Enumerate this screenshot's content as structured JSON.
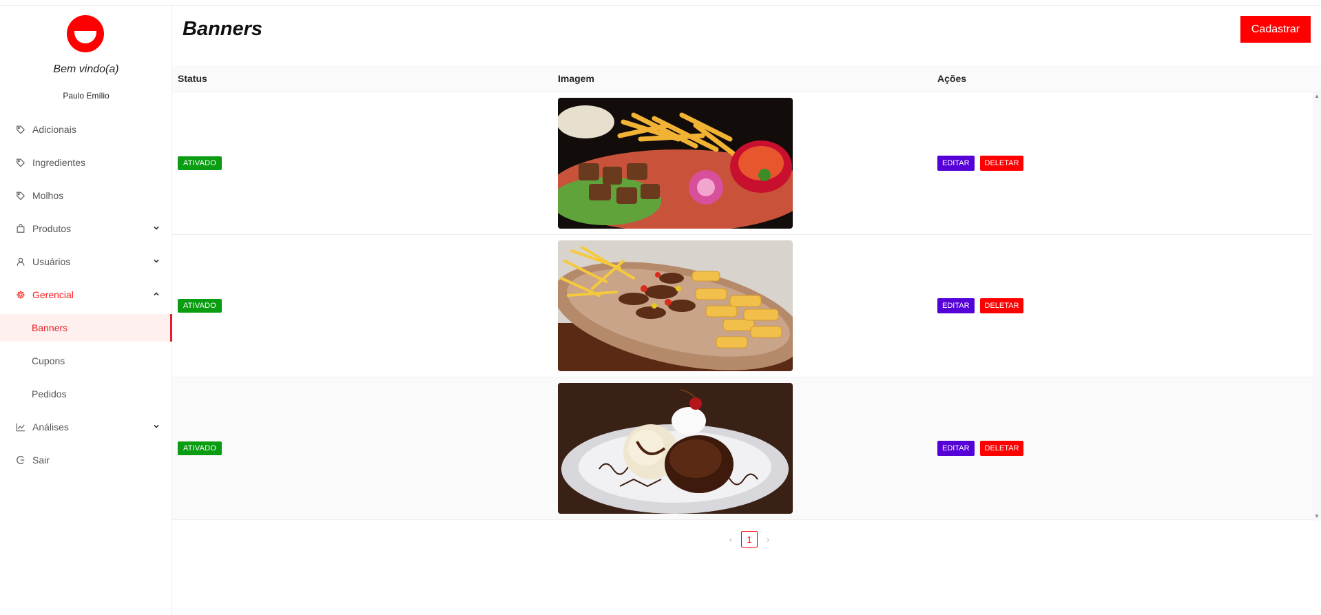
{
  "sidebar": {
    "welcome": "Bem vindo(a)",
    "username": "Paulo Emílio",
    "items": [
      {
        "label": "Adicionais",
        "icon": "tag-icon"
      },
      {
        "label": "Ingredientes",
        "icon": "tag-icon"
      },
      {
        "label": "Molhos",
        "icon": "tag-icon"
      },
      {
        "label": "Produtos",
        "icon": "shopping-bag-icon",
        "expandable": true
      },
      {
        "label": "Usuários",
        "icon": "user-icon",
        "expandable": true
      },
      {
        "label": "Gerencial",
        "icon": "gear-icon",
        "expanded": true,
        "active": true
      },
      {
        "label": "Análises",
        "icon": "line-chart-icon",
        "expandable": true
      },
      {
        "label": "Sair",
        "icon": "logout-icon"
      }
    ],
    "gerencial_sub": [
      {
        "label": "Banners",
        "selected": true
      },
      {
        "label": "Cupons"
      },
      {
        "label": "Pedidos"
      }
    ]
  },
  "header": {
    "title": "Banners",
    "create_label": "Cadastrar"
  },
  "table": {
    "columns": [
      "Status",
      "Imagem",
      "Ações"
    ],
    "rows": [
      {
        "status": "ATIVADO",
        "image": "food-platter-image",
        "edit": "EDITAR",
        "delete": "DELETAR"
      },
      {
        "status": "ATIVADO",
        "image": "beef-fries-image",
        "edit": "EDITAR",
        "delete": "DELETAR"
      },
      {
        "status": "ATIVADO",
        "image": "brownie-dessert-image",
        "edit": "EDITAR",
        "delete": "DELETAR"
      }
    ]
  },
  "pagination": {
    "current_page": "1",
    "prev_icon": "chevron-left-icon",
    "next_icon": "chevron-right-icon"
  },
  "colors": {
    "brand": "#fe0000",
    "active_badge": "#0a9d12",
    "edit_button": "#5500d6",
    "selected_bg": "#fff0f0"
  }
}
